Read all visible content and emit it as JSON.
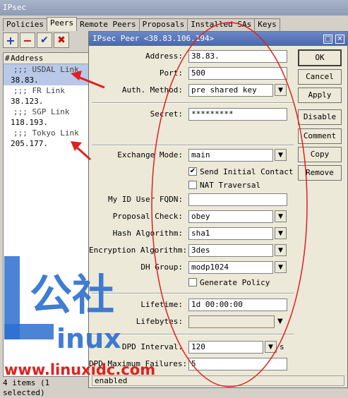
{
  "outer": {
    "title": "IPsec",
    "tabs": [
      "Policies",
      "Peers",
      "Remote Peers",
      "Proposals",
      "Installed SAs",
      "Keys"
    ],
    "active_tab": 1,
    "list_header": {
      "hash": "#",
      "address": "Address"
    },
    "rows": [
      {
        "text": ";;; USDAL Link",
        "kind": "comment"
      },
      {
        "text": "38.83.",
        "kind": "data",
        "selected": true
      },
      {
        "text": ";;; FR Link",
        "kind": "comment"
      },
      {
        "text": "38.123.",
        "kind": "data"
      },
      {
        "text": ";;; SGP Link",
        "kind": "comment"
      },
      {
        "text": "118.193.",
        "kind": "data"
      },
      {
        "text": ";;; Tokyo Link",
        "kind": "comment"
      },
      {
        "text": "205.177.",
        "kind": "data"
      }
    ],
    "status": "4 items (1 selected)"
  },
  "dialog": {
    "title": "IPsec Peer <38.83.106.194>",
    "fields": {
      "address": {
        "label": "Address:",
        "value": "38.83."
      },
      "port": {
        "label": "Port:",
        "value": "500"
      },
      "auth_method": {
        "label": "Auth. Method:",
        "value": "pre shared key"
      },
      "secret": {
        "label": "Secret:",
        "value": "*********"
      },
      "exchange_mode": {
        "label": "Exchange Mode:",
        "value": "main"
      },
      "send_initial_contact": {
        "label": "Send Initial Contact",
        "checked": true
      },
      "nat_traversal": {
        "label": "NAT Traversal",
        "checked": false
      },
      "my_id_user_fqdn": {
        "label": "My ID User FQDN:",
        "value": ""
      },
      "proposal_check": {
        "label": "Proposal Check:",
        "value": "obey"
      },
      "hash_algorithm": {
        "label": "Hash Algorithm:",
        "value": "sha1"
      },
      "encryption_algorithm": {
        "label": "Encryption Algorithm:",
        "value": "3des"
      },
      "dh_group": {
        "label": "DH Group:",
        "value": "modp1024"
      },
      "generate_policy": {
        "label": "Generate Policy",
        "checked": false
      },
      "lifetime": {
        "label": "Lifetime:",
        "value": "1d 00:00:00"
      },
      "lifebytes": {
        "label": "Lifebytes:",
        "value": ""
      },
      "dpd_interval": {
        "label": "DPD Interval:",
        "value": "120",
        "unit": "s"
      },
      "dpd_max_failures": {
        "label": "DPD Maximum Failures:",
        "value": "5"
      }
    },
    "buttons": {
      "ok": "OK",
      "cancel": "Cancel",
      "apply": "Apply",
      "disable": "Disable",
      "comment": "Comment",
      "copy": "Copy",
      "remove": "Remove"
    },
    "status": "enabled"
  },
  "watermark": {
    "line1": "公社",
    "line2": "inux",
    "url": "www.linuxidc.com"
  },
  "colors": {
    "annotation": "#e02020",
    "selection": "#b8c8e8"
  }
}
